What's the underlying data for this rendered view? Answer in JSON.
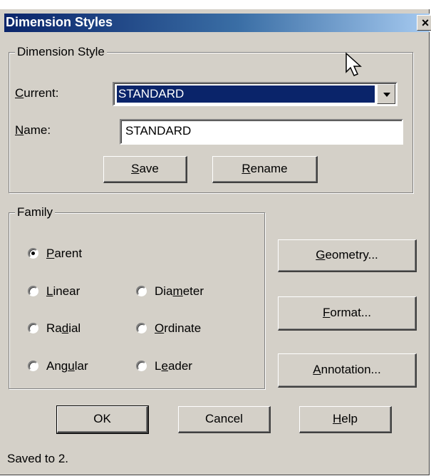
{
  "window": {
    "title": "Dimension Styles",
    "close_glyph": "×"
  },
  "dimension_style": {
    "legend": "Dimension Style",
    "current": {
      "label_accel": "C",
      "label_rest": "urrent:",
      "value": "STANDARD"
    },
    "name": {
      "label_accel": "N",
      "label_rest": "ame:",
      "value": "STANDARD"
    },
    "save": {
      "accel": "S",
      "rest": "ave"
    },
    "rename": {
      "accel": "R",
      "rest": "ename"
    }
  },
  "family": {
    "legend": "Family",
    "options": [
      {
        "pre": "",
        "accel": "P",
        "post": "arent",
        "selected": true
      },
      {
        "pre": "",
        "accel": "L",
        "post": "inear",
        "selected": false
      },
      {
        "pre": "Dia",
        "accel": "m",
        "post": "eter",
        "selected": false
      },
      {
        "pre": "Ra",
        "accel": "d",
        "post": "ial",
        "selected": false
      },
      {
        "pre": "",
        "accel": "O",
        "post": "rdinate",
        "selected": false
      },
      {
        "pre": "Ang",
        "accel": "u",
        "post": "lar",
        "selected": false
      },
      {
        "pre": "L",
        "accel": "e",
        "post": "ader",
        "selected": false
      }
    ]
  },
  "side_buttons": {
    "geometry": {
      "accel": "G",
      "rest": "eometry..."
    },
    "format": {
      "accel": "F",
      "rest": "ormat..."
    },
    "annotation": {
      "accel": "A",
      "rest": "nnotation..."
    }
  },
  "footer": {
    "ok": "OK",
    "cancel": "Cancel",
    "help": {
      "accel": "H",
      "rest": "elp"
    }
  },
  "status": "Saved to 2."
}
